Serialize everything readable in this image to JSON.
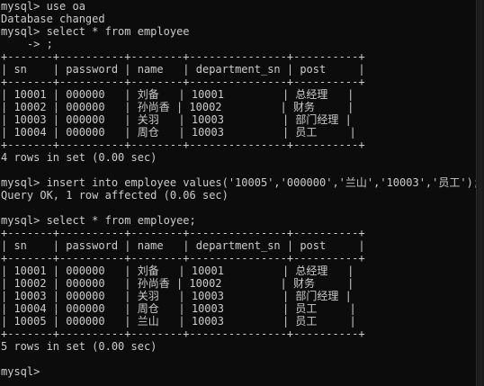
{
  "terminal": {
    "background": "#0c0c0c",
    "foreground": "#cccccc",
    "lines": [
      "mysql> use oa",
      "Database changed",
      "mysql> select * from employee",
      "    -> ;",
      "+-------+----------+--------+---------------+----------+",
      "| sn    | password | name   | department_sn | post     |",
      "+-------+----------+--------+---------------+----------+",
      "| 10001 | 000000   | 刘备   | 10001         | 总经理   |",
      "| 10002 | 000000   | 孙尚香 | 10002         | 财务     |",
      "| 10003 | 000000   | 关羽   | 10003         | 部门经理 |",
      "| 10004 | 000000   | 周仓   | 10003         | 员工     |",
      "+-------+----------+--------+---------------+----------+",
      "4 rows in set (0.00 sec)",
      "",
      "mysql> insert into employee values('10005','000000','兰山','10003','员工');",
      "Query OK, 1 row affected (0.06 sec)",
      "",
      "mysql> select * from employee;",
      "+-------+----------+--------+---------------+----------+",
      "| sn    | password | name   | department_sn | post     |",
      "+-------+----------+--------+---------------+----------+",
      "| 10001 | 000000   | 刘备   | 10001         | 总经理   |",
      "| 10002 | 000000   | 孙尚香 | 10002         | 财务     |",
      "| 10003 | 000000   | 关羽   | 10003         | 部门经理 |",
      "| 10004 | 000000   | 周仓   | 10003         | 员工     |",
      "| 10005 | 000000   | 兰山   | 10003         | 员工     |",
      "+-------+----------+--------+---------------+----------+",
      "5 rows in set (0.00 sec)",
      "",
      "mysql> "
    ]
  }
}
